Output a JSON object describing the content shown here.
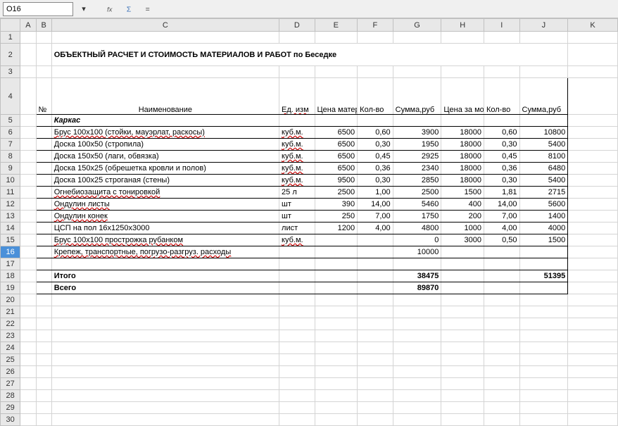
{
  "namebox": "O16",
  "cols": [
    "",
    "A",
    "B",
    "C",
    "D",
    "E",
    "F",
    "G",
    "H",
    "I",
    "J",
    "K"
  ],
  "title": "ОБЪЕКТНЫЙ РАСЧЕТ И СТОИМОСТЬ МАТЕРИАЛОВ И РАБОТ по Беседке",
  "hdr": {
    "num": "№",
    "name": "Наименование",
    "unit": "Ед. изм",
    "price_mat": "Цена материалов ,руб",
    "qty1": "Кол-во",
    "sum1": "Сумма,руб",
    "price_work": "Цена за монтаж, руб",
    "qty2": "Кол-во",
    "sum2": "Сумма,руб"
  },
  "section": "Каркас",
  "rows": [
    {
      "name": "Брус 100х100  (стойки, мауэрлат, раскосы)",
      "unit": "куб.м.",
      "pm": "6500",
      "q1": "0,60",
      "s1": "3900",
      "pw": "18000",
      "q2": "0,60",
      "s2": "10800"
    },
    {
      "name": "Доска 100х50  (стропила)",
      "unit": "куб.м.",
      "pm": "6500",
      "q1": "0,30",
      "s1": "1950",
      "pw": "18000",
      "q2": "0,30",
      "s2": "5400"
    },
    {
      "name": "Доска 150х50 (лаги, обвязка)",
      "unit": "куб.м.",
      "pm": "6500",
      "q1": "0,45",
      "s1": "2925",
      "pw": "18000",
      "q2": "0,45",
      "s2": "8100"
    },
    {
      "name": "Доска 150х25 (обрешетка кровли и полов)",
      "unit": "куб.м.",
      "pm": "6500",
      "q1": "0,36",
      "s1": "2340",
      "pw": "18000",
      "q2": "0,36",
      "s2": "6480"
    },
    {
      "name": "Доска 100х25 строганая  (стены)",
      "unit": "куб.м.",
      "pm": "9500",
      "q1": "0,30",
      "s1": "2850",
      "pw": "18000",
      "q2": "0,30",
      "s2": "5400"
    },
    {
      "name": "Огнебиозащита с тонировкой",
      "unit": "25 л",
      "pm": "2500",
      "q1": "1,00",
      "s1": "2500",
      "pw": "1500",
      "q2": "1,81",
      "s2": "2715"
    },
    {
      "name": "Ондулин листы",
      "unit": "шт",
      "pm": "390",
      "q1": "14,00",
      "s1": "5460",
      "pw": "400",
      "q2": "14,00",
      "s2": "5600"
    },
    {
      "name": "Ондулин  конек",
      "unit": "шт",
      "pm": "250",
      "q1": "7,00",
      "s1": "1750",
      "pw": "200",
      "q2": "7,00",
      "s2": "1400"
    },
    {
      "name": "ЦСП на пол 16х1250х3000",
      "unit": "лист",
      "pm": "1200",
      "q1": "4,00",
      "s1": "4800",
      "pw": "1000",
      "q2": "4,00",
      "s2": "4000"
    },
    {
      "name": "Брус 100х100 прострожка рубанком",
      "unit": "куб.м.",
      "pm": "",
      "q1": "",
      "s1": "0",
      "pw": "3000",
      "q2": "0,50",
      "s2": "1500"
    },
    {
      "name": "Крепеж, транспортные, погрузо-разгруз. расходы",
      "unit": "",
      "pm": "",
      "q1": "",
      "s1": "10000",
      "pw": "",
      "q2": "",
      "s2": ""
    }
  ],
  "totals": {
    "itogo_label": "Итого",
    "itogo_s1": "38475",
    "itogo_s2": "51395",
    "vsego_label": "Всего",
    "vsego": "89870"
  },
  "row_labels": [
    "1",
    "2",
    "3",
    "4",
    "5",
    "6",
    "7",
    "8",
    "9",
    "10",
    "11",
    "12",
    "13",
    "14",
    "15",
    "16",
    "17",
    "18",
    "19",
    "20",
    "21",
    "22",
    "23",
    "24",
    "25",
    "26",
    "27",
    "28",
    "29",
    "30"
  ],
  "chart_data": {
    "type": "table",
    "title": "ОБЪЕКТНЫЙ РАСЧЕТ И СТОИМОСТЬ МАТЕРИАЛОВ И РАБОТ по Беседке",
    "columns": [
      "Наименование",
      "Ед. изм",
      "Цена материалов ,руб",
      "Кол-во",
      "Сумма,руб",
      "Цена за монтаж, руб",
      "Кол-во",
      "Сумма,руб"
    ],
    "rows": [
      [
        "Брус 100х100  (стойки, мауэрлат, раскосы)",
        "куб.м.",
        6500,
        0.6,
        3900,
        18000,
        0.6,
        10800
      ],
      [
        "Доска 100х50  (стропила)",
        "куб.м.",
        6500,
        0.3,
        1950,
        18000,
        0.3,
        5400
      ],
      [
        "Доска 150х50 (лаги, обвязка)",
        "куб.м.",
        6500,
        0.45,
        2925,
        18000,
        0.45,
        8100
      ],
      [
        "Доска 150х25 (обрешетка кровли и полов)",
        "куб.м.",
        6500,
        0.36,
        2340,
        18000,
        0.36,
        6480
      ],
      [
        "Доска 100х25 строганая  (стены)",
        "куб.м.",
        9500,
        0.3,
        2850,
        18000,
        0.3,
        5400
      ],
      [
        "Огнебиозащита с тонировкой",
        "25 л",
        2500,
        1.0,
        2500,
        1500,
        1.81,
        2715
      ],
      [
        "Ондулин листы",
        "шт",
        390,
        14.0,
        5460,
        400,
        14.0,
        5600
      ],
      [
        "Ондулин  конек",
        "шт",
        250,
        7.0,
        1750,
        200,
        7.0,
        1400
      ],
      [
        "ЦСП на пол 16х1250х3000",
        "лист",
        1200,
        4.0,
        4800,
        1000,
        4.0,
        4000
      ],
      [
        "Брус 100х100 прострожка рубанком",
        "куб.м.",
        null,
        null,
        0,
        3000,
        0.5,
        1500
      ],
      [
        "Крепеж, транспортные, погрузо-разгруз. расходы",
        "",
        null,
        null,
        10000,
        null,
        null,
        null
      ]
    ],
    "totals": {
      "Итого": [
        38475,
        51395
      ],
      "Всего": 89870
    }
  }
}
